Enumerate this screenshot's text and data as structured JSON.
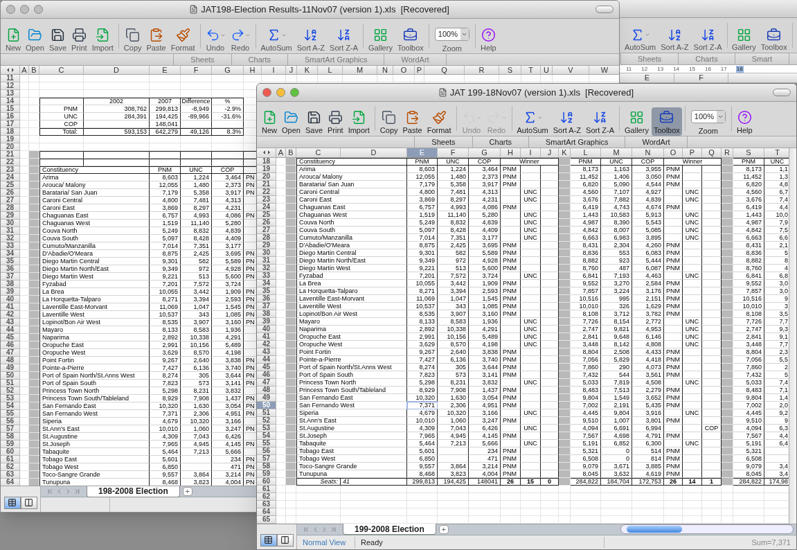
{
  "side_window": {
    "toolbar": [
      {
        "kind": "autosum",
        "label": "AutoSum",
        "disabled": false,
        "active": false
      },
      {
        "kind": "sort_az",
        "label": "Sort A-Z",
        "disabled": false,
        "active": false
      },
      {
        "kind": "sort_za",
        "label": "Sort Z-A",
        "disabled": false,
        "active": false
      },
      {
        "kind": "gallery",
        "label": "Gallery",
        "disabled": false,
        "active": false
      },
      {
        "kind": "toolbox",
        "label": "Toolbox",
        "disabled": false,
        "active": false
      }
    ],
    "ribbon_tabs": [
      "Sheets",
      "Charts",
      "Smart"
    ],
    "ruler": [
      {
        "label": "11",
        "selected": false
      },
      {
        "label": "12",
        "selected": false
      },
      {
        "label": "13",
        "selected": false
      },
      {
        "label": "14",
        "selected": false
      },
      {
        "label": "15",
        "selected": false
      },
      {
        "label": "16",
        "selected": false
      },
      {
        "label": "17",
        "selected": false
      },
      {
        "label": "18",
        "selected": true
      }
    ],
    "columns": [
      "E",
      "F"
    ]
  },
  "back_window": {
    "title": "JAT198-Election Results-11Nov07 (version 1).xls  [Recovered]",
    "active": false,
    "toolbar": [
      {
        "kind": "new",
        "label": "New",
        "disabled": false,
        "active": false
      },
      {
        "kind": "open",
        "label": "Open",
        "disabled": false,
        "active": false
      },
      {
        "kind": "save",
        "label": "Save",
        "disabled": false,
        "active": false
      },
      {
        "kind": "print",
        "label": "Print",
        "disabled": false,
        "active": false
      },
      {
        "kind": "import",
        "label": "Import",
        "disabled": false,
        "active": false
      },
      {
        "kind": "copy",
        "label": "Copy",
        "disabled": false,
        "active": false
      },
      {
        "kind": "paste",
        "label": "Paste",
        "disabled": false,
        "active": false
      },
      {
        "kind": "format",
        "label": "Format",
        "disabled": false,
        "active": false
      },
      {
        "kind": "undo",
        "label": "Undo",
        "disabled": false,
        "active": false
      },
      {
        "kind": "redo",
        "label": "Redo",
        "disabled": false,
        "active": false
      },
      {
        "kind": "autosum",
        "label": "AutoSum",
        "disabled": false,
        "active": false
      },
      {
        "kind": "sort_az",
        "label": "Sort A-Z",
        "disabled": false,
        "active": false
      },
      {
        "kind": "sort_za",
        "label": "Sort Z-A",
        "disabled": false,
        "active": false
      },
      {
        "kind": "gallery",
        "label": "Gallery",
        "disabled": false,
        "active": false
      },
      {
        "kind": "toolbox",
        "label": "Toolbox",
        "disabled": false,
        "active": false
      },
      {
        "kind": "zoom",
        "label": "Zoom",
        "value": "100%"
      },
      {
        "kind": "help",
        "label": "Help",
        "disabled": false,
        "active": false
      }
    ],
    "ribbon_tabs": [
      "Sheets",
      "Charts",
      "SmartArt Graphics",
      "WordArt"
    ],
    "columns": [
      {
        "label": "A",
        "selected": false
      },
      {
        "label": "B",
        "selected": false
      },
      {
        "label": "C",
        "selected": false
      },
      {
        "label": "D",
        "selected": false
      },
      {
        "label": "E",
        "selected": false
      },
      {
        "label": "F",
        "selected": false
      },
      {
        "label": "G",
        "selected": false
      },
      {
        "label": "H",
        "selected": false
      },
      {
        "label": "I",
        "selected": false
      },
      {
        "label": "J",
        "selected": false
      },
      {
        "label": "K",
        "selected": false
      },
      {
        "label": "L",
        "selected": false
      },
      {
        "label": "M",
        "selected": false
      },
      {
        "label": "N",
        "selected": false
      },
      {
        "label": "O",
        "selected": false
      },
      {
        "label": "P",
        "selected": false
      },
      {
        "label": "Q",
        "selected": false
      },
      {
        "label": "R",
        "selected": false
      },
      {
        "label": "S",
        "selected": false
      },
      {
        "label": "T",
        "selected": false
      },
      {
        "label": "U",
        "selected": false
      },
      {
        "label": "V",
        "selected": false
      },
      {
        "label": "W",
        "selected": false
      }
    ],
    "rows": [
      {
        "num": "11",
        "kind": "blank",
        "selected": false,
        "cells": {}
      },
      {
        "num": "12",
        "kind": "blank",
        "selected": false,
        "cells": {}
      },
      {
        "num": "13",
        "kind": "blank",
        "selected": false,
        "cells": {}
      },
      {
        "num": "14",
        "kind": "summary_header",
        "selected": false,
        "cells": {
          "D": "2002",
          "E": "2007",
          "F": "Difference",
          "G": "%"
        }
      },
      {
        "num": "15",
        "kind": "summary",
        "selected": false,
        "cells": {
          "C": "PNM",
          "D": "308,762",
          "E": "299,813",
          "F": "-8,949",
          "G": "-2.9%"
        }
      },
      {
        "num": "16",
        "kind": "summary",
        "selected": false,
        "cells": {
          "C": "UNC",
          "D": "284,391",
          "E": "194,425",
          "F": "-89,966",
          "G": "-31.6%"
        }
      },
      {
        "num": "17",
        "kind": "summary",
        "selected": false,
        "cells": {
          "C": "COP",
          "E": "148,041"
        }
      },
      {
        "num": "18",
        "kind": "summary_total",
        "selected": false,
        "cells": {
          "C": "Total:",
          "D": "593,153",
          "E": "642,279",
          "F": "49,126",
          "G": "8.3%"
        }
      },
      {
        "num": "19",
        "kind": "blank",
        "selected": false,
        "cells": {}
      },
      {
        "num": "20",
        "kind": "blank",
        "selected": false,
        "cells": {}
      },
      {
        "num": "21",
        "kind": "spacer",
        "selected": false,
        "cells": {}
      },
      {
        "num": "22",
        "kind": "spacer",
        "selected": false,
        "cells": {}
      },
      {
        "num": "23",
        "kind": "header",
        "selected": false,
        "cells": {
          "C": "Constituency",
          "E": "PNM",
          "F": "UNC",
          "G": "COP"
        }
      },
      {
        "num": "24",
        "kind": "data",
        "selected": false,
        "cells": {
          "C": "Arima",
          "E": "8,603",
          "F": "1,224",
          "G": "3,464",
          "H": "PN"
        }
      },
      {
        "num": "25",
        "kind": "data",
        "selected": false,
        "cells": {
          "C": "Arouca/ Malony",
          "E": "12,055",
          "F": "1,480",
          "G": "2,373",
          "H": "PN"
        }
      },
      {
        "num": "26",
        "kind": "data",
        "selected": false,
        "cells": {
          "C": "Barataria/ San Juan",
          "E": "7,179",
          "F": "5,358",
          "G": "3,917",
          "H": "PN"
        }
      },
      {
        "num": "27",
        "kind": "data",
        "selected": false,
        "cells": {
          "C": "Caroni Central",
          "E": "4,800",
          "F": "7,481",
          "G": "4,313"
        }
      },
      {
        "num": "28",
        "kind": "data",
        "selected": false,
        "cells": {
          "C": "Caroni East",
          "E": "3,869",
          "F": "8,297",
          "G": "4,231"
        }
      },
      {
        "num": "29",
        "kind": "data",
        "selected": false,
        "cells": {
          "C": "Chaguanas East",
          "E": "6,757",
          "F": "4,993",
          "G": "4,086",
          "H": "PN"
        }
      },
      {
        "num": "30",
        "kind": "data",
        "selected": false,
        "cells": {
          "C": "Chaguanas West",
          "E": "1,519",
          "F": "11,140",
          "G": "5,280"
        }
      },
      {
        "num": "31",
        "kind": "data",
        "selected": false,
        "cells": {
          "C": "Couva North",
          "E": "5,249",
          "F": "8,832",
          "G": "4,839"
        }
      },
      {
        "num": "32",
        "kind": "data",
        "selected": false,
        "cells": {
          "C": "Couva South",
          "E": "5,097",
          "F": "8,428",
          "G": "4,409"
        }
      },
      {
        "num": "33",
        "kind": "data",
        "selected": false,
        "cells": {
          "C": "Cumuto/Manzanilla",
          "E": "7,014",
          "F": "7,351",
          "G": "3,177"
        }
      },
      {
        "num": "34",
        "kind": "data",
        "selected": false,
        "cells": {
          "C": "D'Abadie/O'Meara",
          "E": "8,875",
          "F": "2,425",
          "G": "3,695",
          "H": "PN"
        }
      },
      {
        "num": "35",
        "kind": "data",
        "selected": false,
        "cells": {
          "C": "Diego Martin Central",
          "E": "9,301",
          "F": "582",
          "G": "5,589",
          "H": "PN"
        }
      },
      {
        "num": "36",
        "kind": "data",
        "selected": false,
        "cells": {
          "C": "Diego Martin North/East",
          "E": "9,349",
          "F": "972",
          "G": "4,928",
          "H": "PN"
        }
      },
      {
        "num": "37",
        "kind": "data",
        "selected": false,
        "cells": {
          "C": "Diego Martin West",
          "E": "9,221",
          "F": "513",
          "G": "5,600",
          "H": "PN"
        }
      },
      {
        "num": "38",
        "kind": "data",
        "selected": false,
        "cells": {
          "C": "Fyzabad",
          "E": "7,201",
          "F": "7,572",
          "G": "3,724"
        }
      },
      {
        "num": "39",
        "kind": "data",
        "selected": false,
        "cells": {
          "C": "La Brea",
          "E": "10,055",
          "F": "3,442",
          "G": "1,909",
          "H": "PN"
        }
      },
      {
        "num": "40",
        "kind": "data",
        "selected": false,
        "cells": {
          "C": "La Horquetta-Talparo",
          "E": "8,271",
          "F": "3,394",
          "G": "2,593",
          "H": "PN"
        }
      },
      {
        "num": "41",
        "kind": "data",
        "selected": false,
        "cells": {
          "C": "Laventille East-Morvant",
          "E": "11,069",
          "F": "1,047",
          "G": "1,545",
          "H": "PN"
        }
      },
      {
        "num": "42",
        "kind": "data",
        "selected": false,
        "cells": {
          "C": "Laventille West",
          "E": "10,537",
          "F": "343",
          "G": "1,085",
          "H": "PN"
        }
      },
      {
        "num": "43",
        "kind": "data",
        "selected": false,
        "cells": {
          "C": "Lopinot/Bon Air West",
          "E": "8,535",
          "F": "3,907",
          "G": "3,160",
          "H": "PN"
        }
      },
      {
        "num": "44",
        "kind": "data",
        "selected": false,
        "cells": {
          "C": "Mayaro",
          "E": "8,133",
          "F": "8,583",
          "G": "1,936"
        }
      },
      {
        "num": "45",
        "kind": "data",
        "selected": false,
        "cells": {
          "C": "Naparima",
          "E": "2,892",
          "F": "10,338",
          "G": "4,291"
        }
      },
      {
        "num": "46",
        "kind": "data",
        "selected": false,
        "cells": {
          "C": "Oropuche East",
          "E": "2,991",
          "F": "10,156",
          "G": "5,489"
        }
      },
      {
        "num": "47",
        "kind": "data",
        "selected": false,
        "cells": {
          "C": "Oropuche West",
          "E": "3,629",
          "F": "8,570",
          "G": "4,198"
        }
      },
      {
        "num": "48",
        "kind": "data",
        "selected": false,
        "cells": {
          "C": "Point Fortin",
          "E": "9,267",
          "F": "2,640",
          "G": "3,838",
          "H": "PN"
        }
      },
      {
        "num": "49",
        "kind": "data",
        "selected": false,
        "cells": {
          "C": "Pointe-a-Pierre",
          "E": "7,427",
          "F": "6,136",
          "G": "3,740",
          "H": "PN"
        }
      },
      {
        "num": "50",
        "kind": "data",
        "selected": false,
        "cells": {
          "C": "Port of Spain North/St.Anns West",
          "E": "8,274",
          "F": "305",
          "G": "3,644",
          "H": "PN"
        }
      },
      {
        "num": "51",
        "kind": "data",
        "selected": false,
        "cells": {
          "C": "Port of Spain South",
          "E": "7,823",
          "F": "573",
          "G": "3,141",
          "H": "PN"
        }
      },
      {
        "num": "52",
        "kind": "data",
        "selected": false,
        "cells": {
          "C": "Princess Town North",
          "E": "5,298",
          "F": "8,231",
          "G": "3,832"
        }
      },
      {
        "num": "53",
        "kind": "data",
        "selected": false,
        "cells": {
          "C": "Princess Town South/Tableland",
          "E": "8,929",
          "F": "7,908",
          "G": "1,437",
          "H": "PN"
        }
      },
      {
        "num": "54",
        "kind": "data",
        "selected": false,
        "cells": {
          "C": "San Fernando East",
          "E": "10,320",
          "F": "1,630",
          "G": "3,054",
          "H": "PN"
        }
      },
      {
        "num": "55",
        "kind": "data",
        "selected": false,
        "cells": {
          "C": "San Fernando West",
          "E": "7,371",
          "F": "2,306",
          "G": "4,951",
          "H": "PN"
        }
      },
      {
        "num": "56",
        "kind": "data",
        "selected": false,
        "cells": {
          "C": "Siperia",
          "E": "4,679",
          "F": "10,320",
          "G": "3,166"
        }
      },
      {
        "num": "57",
        "kind": "data",
        "selected": false,
        "cells": {
          "C": "St.Ann's East",
          "E": "10,010",
          "F": "1,060",
          "G": "3,247",
          "H": "PN"
        }
      },
      {
        "num": "58",
        "kind": "data",
        "selected": false,
        "cells": {
          "C": "St.Augustine",
          "E": "4,309",
          "F": "7,043",
          "G": "6,426"
        }
      },
      {
        "num": "59",
        "kind": "data",
        "selected": false,
        "cells": {
          "C": "St.Joseph",
          "E": "7,965",
          "F": "4,945",
          "G": "4,145",
          "H": "PN"
        }
      },
      {
        "num": "60",
        "kind": "data",
        "selected": false,
        "cells": {
          "C": "Tabaquite",
          "E": "5,464",
          "F": "7,213",
          "G": "5,666"
        }
      },
      {
        "num": "61",
        "kind": "data",
        "selected": false,
        "cells": {
          "C": "Tobago East",
          "E": "5,601",
          "G": "234",
          "H": "PN"
        }
      },
      {
        "num": "62",
        "kind": "data",
        "selected": false,
        "cells": {
          "C": "Tobago West",
          "E": "6,850",
          "G": "471",
          "H": "PN"
        }
      },
      {
        "num": "63",
        "kind": "data",
        "selected": false,
        "cells": {
          "C": "Toco-Sangre Grande",
          "E": "9,557",
          "F": "3,864",
          "G": "3,214",
          "H": "PN"
        }
      },
      {
        "num": "64",
        "kind": "data",
        "selected": false,
        "cells": {
          "C": "Tunupuna",
          "E": "8,468",
          "F": "3,823",
          "G": "4,004",
          "H": "PN"
        }
      }
    ],
    "view_buttons": [
      {
        "kind": "normal",
        "selected": true
      },
      {
        "kind": "page_layout",
        "selected": false
      }
    ],
    "sheet_tab": "198-2008 Election",
    "add_sheet": "+"
  },
  "front_window": {
    "title": "JAT 199-18Nov07 (version 1).xls  [Recovered]",
    "active": true,
    "toolbar": [
      {
        "kind": "new",
        "label": "New",
        "disabled": false,
        "active": false
      },
      {
        "kind": "open",
        "label": "Open",
        "disabled": false,
        "active": false
      },
      {
        "kind": "save",
        "label": "Save",
        "disabled": false,
        "active": false
      },
      {
        "kind": "print",
        "label": "Print",
        "disabled": false,
        "active": false
      },
      {
        "kind": "import",
        "label": "Import",
        "disabled": false,
        "active": false
      },
      {
        "kind": "copy",
        "label": "Copy",
        "disabled": false,
        "active": false
      },
      {
        "kind": "paste",
        "label": "Paste",
        "disabled": false,
        "active": false
      },
      {
        "kind": "format",
        "label": "Format",
        "disabled": false,
        "active": false
      },
      {
        "kind": "undo",
        "label": "Undo",
        "disabled": true,
        "active": false
      },
      {
        "kind": "redo",
        "label": "Redo",
        "disabled": true,
        "active": false
      },
      {
        "kind": "autosum",
        "label": "AutoSum",
        "disabled": false,
        "active": false
      },
      {
        "kind": "sort_az",
        "label": "Sort A-Z",
        "disabled": false,
        "active": false
      },
      {
        "kind": "sort_za",
        "label": "Sort Z-A",
        "disabled": false,
        "active": false
      },
      {
        "kind": "gallery",
        "label": "Gallery",
        "disabled": false,
        "active": false
      },
      {
        "kind": "toolbox",
        "label": "Toolbox",
        "disabled": false,
        "active": true
      },
      {
        "kind": "zoom",
        "label": "Zoom",
        "value": "100%"
      },
      {
        "kind": "help",
        "label": "Help",
        "disabled": false,
        "active": false
      }
    ],
    "ribbon_tabs": [
      "Sheets",
      "Charts",
      "SmartArt Graphics",
      "WordArt"
    ],
    "columns": [
      {
        "label": "A",
        "selected": false
      },
      {
        "label": "B",
        "selected": false
      },
      {
        "label": "C",
        "selected": false
      },
      {
        "label": "D",
        "selected": false
      },
      {
        "label": "E",
        "selected": true
      },
      {
        "label": "F",
        "selected": false
      },
      {
        "label": "G",
        "selected": false
      },
      {
        "label": "H",
        "selected": false
      },
      {
        "label": "I",
        "selected": false
      },
      {
        "label": "J",
        "selected": false
      },
      {
        "label": "K",
        "selected": false
      },
      {
        "label": "L",
        "selected": false
      },
      {
        "label": "M",
        "selected": false
      },
      {
        "label": "N",
        "selected": false
      },
      {
        "label": "O",
        "selected": false
      },
      {
        "label": "P",
        "selected": false
      },
      {
        "label": "Q",
        "selected": false
      },
      {
        "label": "R",
        "selected": false
      },
      {
        "label": "S",
        "selected": false
      },
      {
        "label": "T",
        "selected": false
      }
    ],
    "rows": [
      {
        "num": "18",
        "kind": "header",
        "selected": false,
        "cells": {
          "C": "Constituency",
          "E": "PNM",
          "F": "UNC",
          "G": "COP",
          "H": "Winner",
          "L": "PNM",
          "M": "UNC",
          "N": "COP",
          "O": "Winner",
          "S": "PNM",
          "T": "UNC"
        }
      },
      {
        "num": "19",
        "kind": "data",
        "selected": false,
        "cells": {
          "C": "Arima",
          "E": "8,603",
          "F": "1,224",
          "G": "3,464",
          "H": "PNM",
          "L": "8,173",
          "M": "1,163",
          "N": "3,955",
          "O": "PNM",
          "S": "8,173",
          "T": "1,1"
        }
      },
      {
        "num": "20",
        "kind": "data",
        "selected": false,
        "cells": {
          "C": "Arouca/ Malony",
          "E": "12,055",
          "F": "1,480",
          "G": "2,373",
          "H": "PNM",
          "L": "11,452",
          "M": "1,406",
          "N": "3,050",
          "O": "PNM",
          "S": "11,452",
          "T": "1,3"
        }
      },
      {
        "num": "21",
        "kind": "data",
        "selected": false,
        "cells": {
          "C": "Barataria/ San Juan",
          "E": "7,179",
          "F": "5,358",
          "G": "3,917",
          "H": "PNM",
          "L": "6,820",
          "M": "5,090",
          "N": "4,544",
          "O": "PNM",
          "S": "6,820",
          "T": "4,8"
        }
      },
      {
        "num": "22",
        "kind": "data",
        "selected": false,
        "cells": {
          "C": "Caroni Central",
          "E": "4,800",
          "F": "7,481",
          "G": "4,313",
          "I": "UNC",
          "L": "4,560",
          "M": "7,107",
          "N": "4,927",
          "P": "UNC",
          "S": "4,560",
          "T": "6,7"
        }
      },
      {
        "num": "23",
        "kind": "data",
        "selected": false,
        "cells": {
          "C": "Caroni East",
          "E": "3,869",
          "F": "8,297",
          "G": "4,231",
          "I": "UNC",
          "L": "3,676",
          "M": "7,882",
          "N": "4,839",
          "P": "UNC",
          "S": "3,676",
          "T": "7,4"
        }
      },
      {
        "num": "24",
        "kind": "data",
        "selected": false,
        "cells": {
          "C": "Chaguanas East",
          "E": "6,757",
          "F": "4,993",
          "G": "4,086",
          "H": "PNM",
          "L": "6,419",
          "M": "4,743",
          "N": "4,674",
          "O": "PNM",
          "S": "6,419",
          "T": "4,4"
        }
      },
      {
        "num": "25",
        "kind": "data",
        "selected": false,
        "cells": {
          "C": "Chaguanas West",
          "E": "1,519",
          "F": "11,140",
          "G": "5,280",
          "I": "UNC",
          "L": "1,443",
          "M": "10,583",
          "N": "5,913",
          "P": "UNC",
          "S": "1,443",
          "T": "10,0"
        }
      },
      {
        "num": "26",
        "kind": "data",
        "selected": false,
        "cells": {
          "C": "Couva North",
          "E": "5,249",
          "F": "8,832",
          "G": "4,839",
          "I": "UNC",
          "L": "4,987",
          "M": "8,390",
          "N": "5,543",
          "P": "UNC",
          "S": "4,987",
          "T": "7,9"
        }
      },
      {
        "num": "27",
        "kind": "data",
        "selected": false,
        "cells": {
          "C": "Couva South",
          "E": "5,097",
          "F": "8,428",
          "G": "4,409",
          "I": "UNC",
          "L": "4,842",
          "M": "8,007",
          "N": "5,085",
          "P": "UNC",
          "S": "4,842",
          "T": "7,5"
        }
      },
      {
        "num": "28",
        "kind": "data",
        "selected": false,
        "cells": {
          "C": "Cumuto/Manzanilla",
          "E": "7,014",
          "F": "7,351",
          "G": "3,177",
          "I": "UNC",
          "L": "6,663",
          "M": "6,983",
          "N": "3,895",
          "P": "UNC",
          "S": "6,663",
          "T": "6,6"
        }
      },
      {
        "num": "29",
        "kind": "data",
        "selected": false,
        "cells": {
          "C": "D'Abadie/O'Meara",
          "E": "8,875",
          "F": "2,425",
          "G": "3,695",
          "H": "PNM",
          "L": "8,431",
          "M": "2,304",
          "N": "4,260",
          "O": "PNM",
          "S": "8,431",
          "T": "2,1"
        }
      },
      {
        "num": "30",
        "kind": "data",
        "selected": false,
        "cells": {
          "C": "Diego Martin Central",
          "E": "9,301",
          "F": "582",
          "G": "5,589",
          "H": "PNM",
          "L": "8,836",
          "M": "553",
          "N": "6,083",
          "O": "PNM",
          "S": "8,836",
          "T": "5"
        }
      },
      {
        "num": "31",
        "kind": "data",
        "selected": false,
        "cells": {
          "C": "Diego Martin North/East",
          "E": "9,349",
          "F": "972",
          "G": "4,928",
          "H": "PNM",
          "L": "8,882",
          "M": "923",
          "N": "5,444",
          "O": "PNM",
          "S": "8,882",
          "T": "8"
        }
      },
      {
        "num": "32",
        "kind": "data",
        "selected": false,
        "cells": {
          "C": "Diego Martin West",
          "E": "9,221",
          "F": "513",
          "G": "5,600",
          "H": "PNM",
          "L": "8,760",
          "M": "487",
          "N": "6,087",
          "O": "PNM",
          "S": "8,760",
          "T": "4"
        }
      },
      {
        "num": "33",
        "kind": "data",
        "selected": false,
        "cells": {
          "C": "Fyzabad",
          "E": "7,201",
          "F": "7,572",
          "G": "3,724",
          "I": "UNC",
          "L": "6,841",
          "M": "7,193",
          "N": "4,463",
          "P": "UNC",
          "S": "6,841",
          "T": "6,8"
        }
      },
      {
        "num": "34",
        "kind": "data",
        "selected": false,
        "cells": {
          "C": "La Brea",
          "E": "10,055",
          "F": "3,442",
          "G": "1,909",
          "H": "PNM",
          "L": "9,552",
          "M": "3,270",
          "N": "2,584",
          "O": "PNM",
          "S": "9,552",
          "T": "3,0"
        }
      },
      {
        "num": "35",
        "kind": "data",
        "selected": false,
        "cells": {
          "C": "La Horquetta-Talparo",
          "E": "8,271",
          "F": "3,394",
          "G": "2,593",
          "H": "PNM",
          "L": "7,857",
          "M": "3,224",
          "N": "3,176",
          "O": "PNM",
          "S": "7,857",
          "T": "3,0"
        }
      },
      {
        "num": "36",
        "kind": "data",
        "selected": false,
        "cells": {
          "C": "Laventille East-Morvant",
          "E": "11,069",
          "F": "1,047",
          "G": "1,545",
          "H": "PNM",
          "L": "10,516",
          "M": "995",
          "N": "2,151",
          "O": "PNM",
          "S": "10,516",
          "T": "9"
        }
      },
      {
        "num": "37",
        "kind": "data",
        "selected": false,
        "cells": {
          "C": "Laventille West",
          "E": "10,537",
          "F": "343",
          "G": "1,085",
          "H": "PNM",
          "L": "10,010",
          "M": "326",
          "N": "1,629",
          "O": "PNM",
          "S": "10,010",
          "T": "3"
        }
      },
      {
        "num": "38",
        "kind": "data",
        "selected": false,
        "cells": {
          "C": "Lopinot/Bon Air West",
          "E": "8,535",
          "F": "3,907",
          "G": "3,160",
          "H": "PNM",
          "L": "8,108",
          "M": "3,712",
          "N": "3,782",
          "O": "PNM",
          "S": "8,108",
          "T": "3,5"
        }
      },
      {
        "num": "39",
        "kind": "data",
        "selected": false,
        "cells": {
          "C": "Mayaro",
          "E": "8,133",
          "F": "8,583",
          "G": "1,936",
          "I": "UNC",
          "L": "7,726",
          "M": "8,154",
          "N": "2,772",
          "P": "UNC",
          "S": "7,726",
          "T": "7,7"
        }
      },
      {
        "num": "40",
        "kind": "data",
        "selected": false,
        "cells": {
          "C": "Naparima",
          "E": "2,892",
          "F": "10,338",
          "G": "4,291",
          "I": "UNC",
          "L": "2,747",
          "M": "9,821",
          "N": "4,953",
          "P": "UNC",
          "S": "2,747",
          "T": "9,3"
        }
      },
      {
        "num": "41",
        "kind": "data",
        "selected": false,
        "cells": {
          "C": "Oropuche East",
          "E": "2,991",
          "F": "10,156",
          "G": "5,489",
          "I": "UNC",
          "L": "2,841",
          "M": "9,648",
          "N": "6,146",
          "P": "UNC",
          "S": "2,841",
          "T": "9,1"
        }
      },
      {
        "num": "42",
        "kind": "data",
        "selected": false,
        "cells": {
          "C": "Oropuche West",
          "E": "3,629",
          "F": "8,570",
          "G": "4,198",
          "I": "UNC",
          "L": "3,448",
          "M": "8,142",
          "N": "4,808",
          "P": "UNC",
          "S": "3,448",
          "T": "7,7"
        }
      },
      {
        "num": "43",
        "kind": "data",
        "selected": false,
        "cells": {
          "C": "Point Fortin",
          "E": "9,267",
          "F": "2,640",
          "G": "3,838",
          "H": "PNM",
          "L": "8,804",
          "M": "2,508",
          "N": "4,433",
          "O": "PNM",
          "S": "8,804",
          "T": "2,3"
        }
      },
      {
        "num": "44",
        "kind": "data",
        "selected": false,
        "cells": {
          "C": "Pointe-a-Pierre",
          "E": "7,427",
          "F": "6,136",
          "G": "3,740",
          "H": "PNM",
          "L": "7,056",
          "M": "5,829",
          "N": "4,418",
          "O": "PNM",
          "S": "7,056",
          "T": "5,5"
        }
      },
      {
        "num": "45",
        "kind": "data",
        "selected": false,
        "cells": {
          "C": "Port of Spain North/St.Anns West",
          "E": "8,274",
          "F": "305",
          "G": "3,644",
          "H": "PNM",
          "L": "7,860",
          "M": "290",
          "N": "4,073",
          "O": "PNM",
          "S": "7,860",
          "T": "2"
        }
      },
      {
        "num": "46",
        "kind": "data",
        "selected": false,
        "cells": {
          "C": "Port of Spain South",
          "E": "7,823",
          "F": "573",
          "G": "3,141",
          "H": "PNM",
          "L": "7,432",
          "M": "544",
          "N": "3,561",
          "O": "PNM",
          "S": "7,432",
          "T": "5"
        }
      },
      {
        "num": "47",
        "kind": "data",
        "selected": false,
        "cells": {
          "C": "Princess Town North",
          "E": "5,298",
          "F": "8,231",
          "G": "3,832",
          "I": "UNC",
          "L": "5,033",
          "M": "7,819",
          "N": "4,508",
          "P": "UNC",
          "S": "5,033",
          "T": "7,4"
        }
      },
      {
        "num": "48",
        "kind": "data",
        "selected": false,
        "cells": {
          "C": "Princess Town South/Tableland",
          "E": "8,929",
          "F": "7,908",
          "G": "1,437",
          "H": "PNM",
          "L": "8,483",
          "M": "7,513",
          "N": "2,279",
          "O": "PNM",
          "S": "8,483",
          "T": "7,1"
        }
      },
      {
        "num": "49",
        "kind": "data",
        "selected": false,
        "cells": {
          "C": "San Fernando East",
          "E": "10,320",
          "F": "1,630",
          "G": "3,054",
          "H": "PNM",
          "L": "9,804",
          "M": "1,549",
          "N": "3,652",
          "O": "PNM",
          "S": "9,804",
          "T": "1,4"
        }
      },
      {
        "num": "50",
        "kind": "data",
        "selected": true,
        "cells": {
          "C": "San Fernando West",
          "E": "7,371",
          "F": "2,306",
          "G": "4,951",
          "H": "PNM",
          "L": "7,002",
          "M": "2,191",
          "N": "5,435",
          "O": "PNM",
          "S": "7,002",
          "T": "2,0"
        }
      },
      {
        "num": "51",
        "kind": "data",
        "selected": false,
        "cells": {
          "C": "Siperia",
          "E": "4,679",
          "F": "10,320",
          "G": "3,166",
          "I": "UNC",
          "L": "4,445",
          "M": "9,804",
          "N": "3,916",
          "P": "UNC",
          "S": "4,445",
          "T": "9,2"
        }
      },
      {
        "num": "52",
        "kind": "data",
        "selected": false,
        "cells": {
          "C": "St.Ann's East",
          "E": "10,010",
          "F": "1,060",
          "G": "3,247",
          "H": "PNM",
          "L": "9,510",
          "M": "1,007",
          "N": "3,801",
          "O": "PNM",
          "S": "9,510",
          "T": "9"
        }
      },
      {
        "num": "53",
        "kind": "data",
        "selected": false,
        "cells": {
          "C": "St.Augustine",
          "E": "4,309",
          "F": "7,043",
          "G": "6,426",
          "I": "UNC",
          "L": "4,094",
          "M": "6,691",
          "N": "6,994",
          "Q": "COP",
          "S": "4,094",
          "T": "6,3"
        }
      },
      {
        "num": "54",
        "kind": "data",
        "selected": false,
        "cells": {
          "C": "St.Joseph",
          "E": "7,965",
          "F": "4,945",
          "G": "4,145",
          "H": "PNM",
          "L": "7,567",
          "M": "4,698",
          "N": "4,791",
          "O": "PNM",
          "S": "7,567",
          "T": "4,4"
        }
      },
      {
        "num": "55",
        "kind": "data",
        "selected": false,
        "cells": {
          "C": "Tabaquite",
          "E": "5,464",
          "F": "7,213",
          "G": "5,666",
          "I": "UNC",
          "L": "5,191",
          "M": "6,852",
          "N": "6,300",
          "P": "UNC",
          "S": "5,191",
          "T": "6,4"
        }
      },
      {
        "num": "56",
        "kind": "data",
        "selected": false,
        "cells": {
          "C": "Tobago East",
          "E": "5,601",
          "G": "234",
          "H": "PNM",
          "L": "5,321",
          "M": "0",
          "N": "514",
          "O": "PNM",
          "S": "5,321"
        }
      },
      {
        "num": "57",
        "kind": "data",
        "selected": false,
        "cells": {
          "C": "Tobago West",
          "E": "6,850",
          "G": "471",
          "H": "PNM",
          "L": "6,508",
          "M": "0",
          "N": "814",
          "O": "PNM",
          "S": "6,508"
        }
      },
      {
        "num": "58",
        "kind": "data",
        "selected": false,
        "cells": {
          "C": "Toco-Sangre Grande",
          "E": "9,557",
          "F": "3,864",
          "G": "3,214",
          "H": "PNM",
          "L": "9,079",
          "M": "3,671",
          "N": "3,885",
          "O": "PNM",
          "S": "9,079",
          "T": "3,4"
        }
      },
      {
        "num": "59",
        "kind": "data",
        "selected": false,
        "cells": {
          "C": "Tunupuna",
          "E": "8,468",
          "F": "3,823",
          "G": "4,004",
          "H": "PNM",
          "L": "8,045",
          "M": "3,632",
          "N": "4,619",
          "O": "PNM",
          "S": "8,045",
          "T": "3,4"
        }
      },
      {
        "num": "60",
        "kind": "total",
        "selected": false,
        "cells": {
          "C": "Seats:",
          "D": "41",
          "E": "299,813",
          "F": "194,425",
          "G": "148041",
          "H": "26",
          "I": "15",
          "J": "0",
          "L": "284,822",
          "M": "184,704",
          "N": "172,753",
          "O": "26",
          "P": "14",
          "Q": "1",
          "S": "284,822",
          "T": "174,98"
        }
      },
      {
        "num": "61",
        "kind": "blank",
        "selected": false,
        "cells": {}
      },
      {
        "num": "62",
        "kind": "blank",
        "selected": false,
        "cells": {}
      },
      {
        "num": "63",
        "kind": "blank",
        "selected": false,
        "cells": {}
      },
      {
        "num": "64",
        "kind": "blank",
        "selected": false,
        "cells": {}
      },
      {
        "num": "65",
        "kind": "blank",
        "selected": false,
        "cells": {}
      }
    ],
    "view_buttons": [
      {
        "kind": "normal",
        "selected": true
      },
      {
        "kind": "page_layout",
        "selected": false
      }
    ],
    "sheet_tab": "199-2008 Election",
    "add_sheet": "+",
    "status": {
      "view": "Normal View",
      "state": "Ready",
      "sum": "Sum=7,371"
    }
  }
}
